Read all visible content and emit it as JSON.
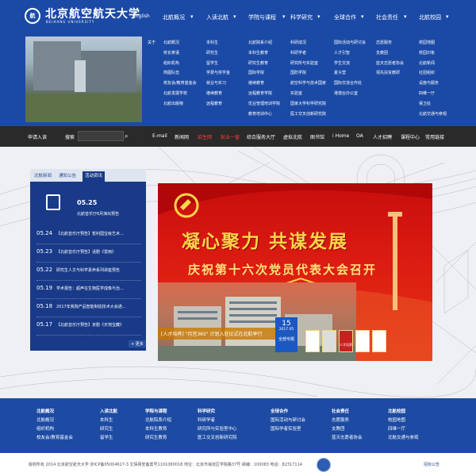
{
  "header": {
    "logo_cn": "北京航空航天大学",
    "logo_en": "BEIHANG UNIVERSITY",
    "lang": "English",
    "nav": [
      "北航概况",
      "入读北航",
      "学院与课程",
      "科学研究",
      "全球合作",
      "社会责任",
      "北航校园"
    ]
  },
  "mega": {
    "col0": [
      "关于"
    ],
    "col1": [
      "北航概况",
      "校长寄语",
      "组织机构",
      "简图队伍",
      "校友会/教育基金会",
      "北航发展学校",
      "北航出版物"
    ],
    "col2": [
      "本科生",
      "研究生",
      "留学生",
      "学费与奖学金",
      "就业与实习",
      "继续教育",
      "远程教育"
    ],
    "col3": [
      "北航院系介绍",
      "本科生教育",
      "研究生教育",
      "国际学院",
      "继续教育",
      "远程教育学院",
      "优业管理培训学院",
      "教育培训中心"
    ],
    "col4": [
      "科研成况",
      "科研学者",
      "研究所与实验室",
      "国防学院",
      "航空科学与技术国家",
      "实验室",
      "国家大学科学研究院",
      "医工交叉创新研究院"
    ],
    "col5": [
      "国际活动与研讨会",
      "人才引智",
      "学生交流",
      "夏令营",
      "国际交流合作处",
      "港澳台办公室"
    ],
    "col6": [
      "志愿服务",
      "支教团",
      "蓝天志愿者协会",
      "领先扶贫教研"
    ],
    "col7": [
      "校园地图",
      "校园印象",
      "北航新闻",
      "社团组织",
      "设施与服务",
      "四维一厅",
      "保卫处",
      "北航交通与参观"
    ]
  },
  "bar": {
    "items": [
      "申请入读",
      "搜索",
      "E-mail",
      "新闻网",
      "招生网",
      "就业一窗",
      "综合服务大厅",
      "虚拟北航",
      "图书馆",
      "i Home",
      "OA",
      "人才招聘",
      "课程中心",
      "常用链接"
    ],
    "search_icon": "search-icon"
  },
  "news": {
    "tabs": [
      "北航新闻",
      "通知公告",
      "活动资讯"
    ],
    "active_tab": 2,
    "featured": {
      "date": "05.25",
      "title": "北航音乐厅6月演出预告"
    },
    "items": [
      {
        "date": "05.24",
        "title": "【北航音乐厅预告】暂利国宝级艺术..."
      },
      {
        "date": "05.23",
        "title": "【北航音乐厅预告】话剧《雷雨》"
      },
      {
        "date": "05.22",
        "title": "研究生人文与科学素养系列讲座预告"
      },
      {
        "date": "05.19",
        "title": "学术报告：超声在生物医学成像与治..."
      },
      {
        "date": "05.18",
        "title": "2017年我院产品智能制造技术大会通..."
      },
      {
        "date": "05.17",
        "title": "【北航音乐厅预告】京剧《天地宝藏》"
      }
    ],
    "more": "+ 更多"
  },
  "banner": {
    "headline": "凝心聚力 共谋发展",
    "subhead": "庆祝第十六次党员代表大会召开",
    "strip": "[人才培养] \"月宫365\" 计划入驻仪式在北航举行",
    "day": "15",
    "month": "2017.05",
    "label": "全部专题",
    "books": [
      "",
      "",
      "人才培养",
      "",
      ""
    ],
    "accent": "#dc1c12"
  },
  "footer": {
    "cols": [
      {
        "h": "北航概况",
        "items": [
          "北航概况",
          "组织机构",
          "校友会/教育基金会"
        ]
      },
      {
        "h": "入读北航",
        "items": [
          "本科生",
          "研究生",
          "留学生"
        ]
      },
      {
        "h": "学院与课程",
        "items": [
          "北航院系介绍",
          "本科生教育",
          "研究生教育"
        ]
      },
      {
        "h": "科学研究",
        "items": [
          "科研学者",
          "研究所与实验室中心",
          "医工交叉创新研究院"
        ]
      },
      {
        "h": "全球合作",
        "items": [
          "国际活动与研讨会",
          "国际学者实验室"
        ]
      },
      {
        "h": "社会责任",
        "items": [
          "志愿服务",
          "支教团",
          "蓝天志愿者协会"
        ]
      },
      {
        "h": "北航校园",
        "items": [
          "校园地图",
          "四维一厅",
          "北航交通与参观"
        ]
      }
    ],
    "copyright": "版权所有 2014 北京航空航天大学  京ICP备05004617-3  文保网安备案号1101080018  地址：北京市海淀区学院路37号  邮编：100083  电话：82317114",
    "right_link": "招标公告"
  }
}
